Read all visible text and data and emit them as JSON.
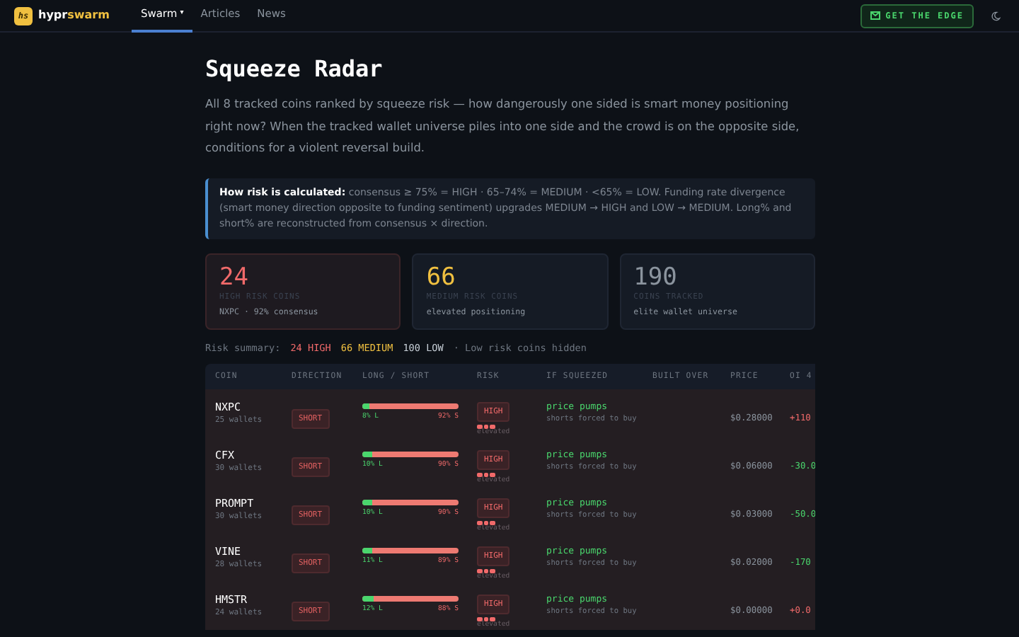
{
  "navbar": {
    "logo": "hs",
    "brand_prefix": "hypr",
    "brand_suffix": "swarm",
    "nav": [
      {
        "label": "Swarm",
        "selected": true,
        "caret": "▾"
      },
      {
        "label": "Articles",
        "selected": false
      },
      {
        "label": "News",
        "selected": false
      }
    ],
    "cta": "GET THE EDGE"
  },
  "title": "Squeeze Radar",
  "intro": "All 8 tracked coins ranked by squeeze risk — how dangerously one sided is smart money positioning right now? When the tracked wallet universe piles into one side and the crowd is on the opposite side, conditions for a violent reversal build.",
  "info": "**How risk is calculated:** consensus ≥ 75% = HIGH · 65–74% = MEDIUM · <65% = LOW. Funding rate divergence (smart money direction opposite to funding sentiment) upgrades MEDIUM → HIGH and LOW → MEDIUM. Long% and short% are reconstructed from consensus × direction.",
  "stats": [
    {
      "kind": "high",
      "value": "24",
      "label": "HIGH RISK COINS",
      "sub": "NXPC · 92% consensus"
    },
    {
      "kind": "medium",
      "value": "66",
      "label": "MEDIUM RISK COINS",
      "sub": "elevated positioning"
    },
    {
      "kind": "neutral",
      "value": "190",
      "label": "COINS TRACKED",
      "sub": "elite wallet universe"
    }
  ],
  "summary": {
    "label": "Risk summary:",
    "items": [
      {
        "kind": "high",
        "text": "24 HIGH"
      },
      {
        "kind": "medium",
        "text": "66 MEDIUM"
      },
      {
        "kind": "low",
        "text": "100 LOW"
      }
    ],
    "note": "· Low risk coins hidden"
  },
  "table": {
    "columns": [
      "COIN",
      "DIRECTION",
      "LONG / SHORT",
      "RISK",
      "IF SQUEEZED",
      "BUILT OVER",
      "PRICE",
      "OI 4"
    ],
    "rows": [
      {
        "coin": "NXPC",
        "wallets": "25 wallets",
        "direction": "SHORT",
        "level": 0.08,
        "long": "8% L",
        "short": "92% S",
        "risk": {
          "label": "HIGH",
          "kind": "high",
          "note": "elevated"
        },
        "effect": "price pumps",
        "effect_note": "shorts forced to buy",
        "price": "$0.28000",
        "oi": {
          "value": "+110",
          "kind": "up"
        }
      },
      {
        "coin": "CFX",
        "wallets": "30 wallets",
        "direction": "SHORT",
        "level": 0.1,
        "long": "10% L",
        "short": "90% S",
        "risk": {
          "label": "HIGH",
          "kind": "high",
          "note": "elevated"
        },
        "effect": "price pumps",
        "effect_note": "shorts forced to buy",
        "price": "$0.06000",
        "oi": {
          "value": "-30.0",
          "kind": "down"
        }
      },
      {
        "coin": "PROMPT",
        "wallets": "30 wallets",
        "direction": "SHORT",
        "level": 0.1,
        "long": "10% L",
        "short": "90% S",
        "risk": {
          "label": "HIGH",
          "kind": "high",
          "note": "elevated"
        },
        "effect": "price pumps",
        "effect_note": "shorts forced to buy",
        "price": "$0.03000",
        "oi": {
          "value": "-50.0",
          "kind": "down"
        }
      },
      {
        "coin": "VINE",
        "wallets": "28 wallets",
        "direction": "SHORT",
        "level": 0.11,
        "long": "11% L",
        "short": "89% S",
        "risk": {
          "label": "HIGH",
          "kind": "high",
          "note": "elevated"
        },
        "effect": "price pumps",
        "effect_note": "shorts forced to buy",
        "price": "$0.02000",
        "oi": {
          "value": "-170",
          "kind": "down"
        }
      },
      {
        "coin": "HMSTR",
        "wallets": "24 wallets",
        "direction": "SHORT",
        "level": 0.12,
        "long": "12% L",
        "short": "88% S",
        "risk": {
          "label": "HIGH",
          "kind": "high",
          "note": "elevated"
        },
        "effect": "price pumps",
        "effect_note": "shorts forced to buy",
        "price": "$0.00000",
        "oi": {
          "value": "+0.0",
          "kind": "up"
        }
      }
    ]
  }
}
